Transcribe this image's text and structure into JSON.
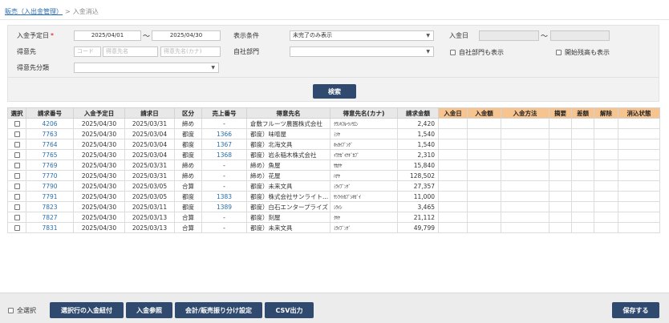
{
  "breadcrumb": {
    "parent": "販売（入出金管理）",
    "separator": ">",
    "current": "入金消込"
  },
  "filters": {
    "due_date_label": "入金予定日",
    "required_mark": "*",
    "due_date_from": "2025/04/01",
    "due_date_to": "2025/04/30",
    "range_sep": "〜",
    "display_condition_label": "表示条件",
    "display_condition_value": "未完了のみ表示",
    "payment_date_label": "入金日",
    "payment_date_from": "",
    "payment_date_to": "",
    "customer_label": "得意先",
    "customer_code_placeholder": "コード",
    "customer_name_placeholder": "得意先名",
    "customer_kana_placeholder": "得意先名(カナ)",
    "own_dept_label": "自社部門",
    "own_dept_value": "",
    "show_own_dept_label": "自社部門も表示",
    "show_opening_balance_label": "開始残高も表示",
    "customer_class_label": "得意先分類",
    "customer_class_value": "",
    "search_label": "検索"
  },
  "table": {
    "headers": [
      "選択",
      "請求番号",
      "入金予定日",
      "請求日",
      "区分",
      "売上番号",
      "得意先名",
      "得意先名(カナ)",
      "請求金額",
      "入金日",
      "入金額",
      "入金方法",
      "摘要",
      "差額",
      "解除",
      "消込状態"
    ],
    "rows": [
      {
        "no": "4206",
        "due": "2025/04/30",
        "bill_date": "2025/03/31",
        "kind": "締め",
        "sales_no": "-",
        "name": "倉敷フルーツ農園株式会社",
        "kana": "ｸﾗｼｷﾌﾙｰﾂﾉｳｴﾝ",
        "amount": "2,420"
      },
      {
        "no": "7763",
        "due": "2025/04/30",
        "bill_date": "2025/03/04",
        "kind": "都度",
        "sales_no": "1366",
        "name": "都度）味噌屋",
        "kana": "ﾐｿﾔ",
        "amount": "1,540"
      },
      {
        "no": "7764",
        "due": "2025/04/30",
        "bill_date": "2025/03/04",
        "kind": "都度",
        "sales_no": "1367",
        "name": "都度）北海文具",
        "kana": "ﾎｯｶｲﾌﾞﾝｸﾞ",
        "amount": "1,540"
      },
      {
        "no": "7765",
        "due": "2025/04/30",
        "bill_date": "2025/03/04",
        "kind": "都度",
        "sales_no": "1368",
        "name": "都度）岩永稲木株式会社",
        "kana": "ｲﾜﾅｶﾞｲﾅｷﾞｶﾌﾞ",
        "amount": "2,310"
      },
      {
        "no": "7769",
        "due": "2025/04/30",
        "bill_date": "2025/03/31",
        "kind": "締め",
        "sales_no": "-",
        "name": "締め）魚屋",
        "kana": "ｻｶﾅﾔ",
        "amount": "15,840"
      },
      {
        "no": "7770",
        "due": "2025/04/30",
        "bill_date": "2025/03/31",
        "kind": "締め",
        "sales_no": "-",
        "name": "締め）花屋",
        "kana": "ﾊﾅﾔ",
        "amount": "128,502"
      },
      {
        "no": "7790",
        "due": "2025/04/30",
        "bill_date": "2025/03/05",
        "kind": "合算",
        "sales_no": "-",
        "name": "都度）未来文具",
        "kana": "ﾐﾗｲﾌﾞﾝｸﾞ",
        "amount": "27,357"
      },
      {
        "no": "7791",
        "due": "2025/04/30",
        "bill_date": "2025/03/05",
        "kind": "都度",
        "sales_no": "1383",
        "name": "都度）株式会社サンライト...",
        "kana": "ｻﾝﾗｲﾄｶﾌﾞｼｷｶﾞｲ",
        "amount": "11,000"
      },
      {
        "no": "7823",
        "due": "2025/04/30",
        "bill_date": "2025/03/11",
        "kind": "都度",
        "sales_no": "1389",
        "name": "都度）白石エンタープライズ",
        "kana": "ｼﾗｲｼ",
        "amount": "3,465"
      },
      {
        "no": "7827",
        "due": "2025/04/30",
        "bill_date": "2025/03/13",
        "kind": "合算",
        "sales_no": "-",
        "name": "都度）刻屋",
        "kana": "ｸｷﾔ",
        "amount": "21,112"
      },
      {
        "no": "7831",
        "due": "2025/04/30",
        "bill_date": "2025/03/13",
        "kind": "合算",
        "sales_no": "-",
        "name": "都度）未来文具",
        "kana": "ﾐﾗｲﾌﾞﾝｸﾞ",
        "amount": "49,799"
      }
    ]
  },
  "footer": {
    "select_all_label": "全選択",
    "btn_link_selected": "選択行の入金紐付",
    "btn_payment_ref": "入金参照",
    "btn_allocation": "会計/販売振り分け設定",
    "btn_csv": "CSV出力",
    "btn_save": "保存する"
  },
  "colors": {
    "accent": "#2f4a6e",
    "link": "#2a6fb0",
    "payment_header": "#f7c38e",
    "required": "#dd0000"
  },
  "icons": {
    "dropdown": "chevron-down-icon",
    "checkbox": "checkbox-icon"
  }
}
